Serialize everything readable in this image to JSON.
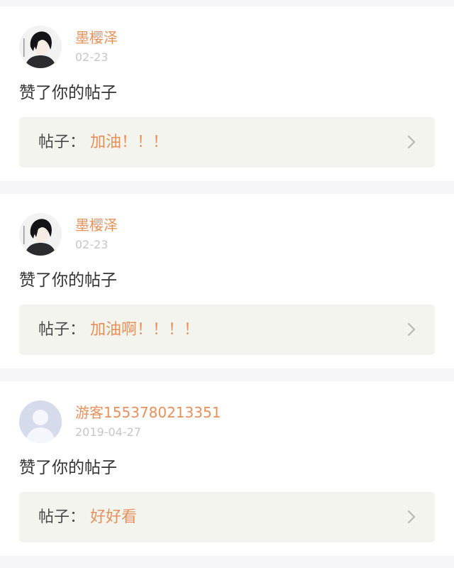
{
  "notifications": [
    {
      "avatar_icon": "anime-boy-avatar",
      "username": "墨樱泽",
      "date": "02-23",
      "action": "赞了你的帖子",
      "post_label": "帖子：",
      "post_title": "加油！！！"
    },
    {
      "avatar_icon": "anime-boy-avatar",
      "username": "墨樱泽",
      "date": "02-23",
      "action": "赞了你的帖子",
      "post_label": "帖子：",
      "post_title": "加油啊！！！！"
    },
    {
      "avatar_icon": "default-user-avatar",
      "username": "游客1553780213351",
      "date": "2019-04-27",
      "action": "赞了你的帖子",
      "post_label": "帖子：",
      "post_title": "好好看"
    }
  ],
  "colors": {
    "accent": "#e6915c",
    "date_text": "#c6c6c6",
    "body_text": "#333333",
    "post_box_bg": "#f4f4ee",
    "page_bg": "#f5f4f6"
  }
}
